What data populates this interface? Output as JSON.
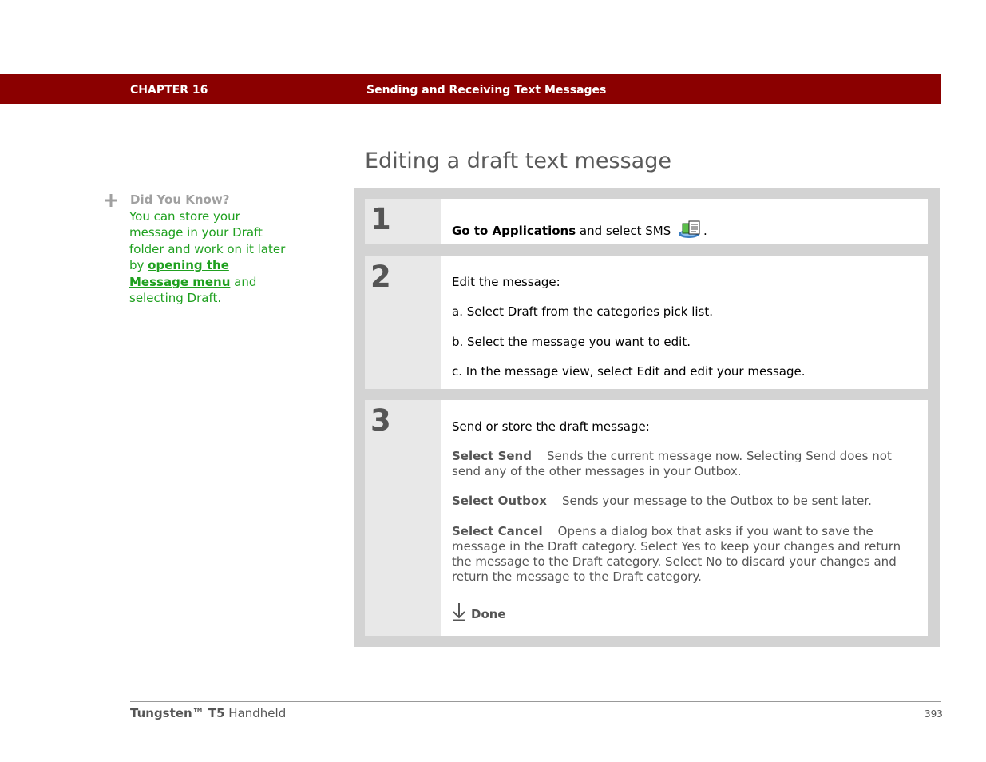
{
  "header": {
    "chapter": "CHAPTER 16",
    "title": "Sending and Receiving Text Messages",
    "bar_color": "#8b0000"
  },
  "section_title": "Editing a draft text message",
  "sidebar": {
    "icon": "plus-icon",
    "heading": "Did You Know?",
    "text_before": "You can store your message in your Draft folder and work on it later by ",
    "link": "opening the Message menu",
    "text_after": " and selecting Draft.",
    "text_color": "#1fa01f"
  },
  "steps": [
    {
      "number": "1",
      "link": "Go to Applications",
      "text": " and select SMS ",
      "icon": "sms-app-icon",
      "suffix": "."
    },
    {
      "number": "2",
      "intro": "Edit the message:",
      "items": [
        "a.  Select Draft from the categories pick list.",
        "b.  Select the message you want to edit.",
        "c.  In the message view, select Edit and edit your message."
      ]
    },
    {
      "number": "3",
      "intro": "Send or store the draft message:",
      "options": [
        {
          "term": "Select Send",
          "desc": "Sends the current message now. Selecting Send does not send any of the other messages in your Outbox."
        },
        {
          "term": "Select Outbox",
          "desc": "Sends your message to the Outbox to be sent later."
        },
        {
          "term": "Select Cancel",
          "desc": "Opens a dialog box that asks if you want to save the message in the Draft category. Select Yes to keep your changes and return the message to the Draft category. Select No to discard your changes and return the message to the Draft category."
        }
      ],
      "done_icon": "done-arrow-icon",
      "done_label": "Done"
    }
  ],
  "footer": {
    "brand": "Tungsten™ T5",
    "product": " Handheld",
    "page": "393"
  }
}
